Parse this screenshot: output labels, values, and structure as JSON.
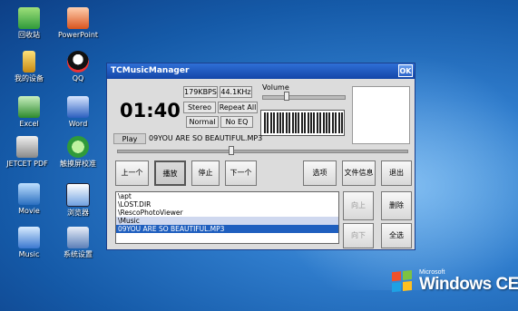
{
  "desktop": {
    "icons": [
      {
        "label": "回收站",
        "icon": "recycle-bin-icon"
      },
      {
        "label": "PowerPoint",
        "icon": "powerpoint-icon"
      },
      {
        "label": "我的设备",
        "icon": "my-device-icon"
      },
      {
        "label": "QQ",
        "icon": "qq-icon"
      },
      {
        "label": "Excel",
        "icon": "excel-icon"
      },
      {
        "label": "Word",
        "icon": "word-icon"
      },
      {
        "label": "JETCET PDF",
        "icon": "jetcet-pdf-icon"
      },
      {
        "label": "触摸屏校准",
        "icon": "touch-calibrate-icon"
      },
      {
        "label": "Movie",
        "icon": "movie-icon"
      },
      {
        "label": "浏览器",
        "icon": "browser-icon"
      },
      {
        "label": "Music",
        "icon": "music-icon"
      },
      {
        "label": "系统设置",
        "icon": "system-settings-icon"
      }
    ],
    "brand": {
      "small": "Microsoft",
      "text": "Windows CE"
    }
  },
  "window": {
    "title": "TCMusicManager",
    "ok_label": "OK",
    "time": "01:40",
    "bitrate": "179KBPS",
    "samplerate": "44.1KHz",
    "channels": "Stereo",
    "repeat": "Repeat All",
    "mode": "Normal",
    "eq": "No EQ",
    "volume_label": "Volume",
    "volume_level": 0.28,
    "seek_position": 0.39,
    "status": "Play",
    "track": "09YOU ARE SO BEAUTIFUL.MP3",
    "buttons": {
      "prev": "上一个",
      "play": "播放",
      "stop": "停止",
      "next": "下一个",
      "options": "选项",
      "file_info": "文件信息",
      "exit": "退出",
      "up": "向上",
      "delete": "删除",
      "down": "向下",
      "select_all": "全选"
    },
    "playlist": [
      "\\apt",
      "\\LOST.DIR",
      "\\RescoPhotoViewer",
      "\\Music",
      "09YOU ARE SO BEAUTIFUL.MP3"
    ],
    "selected_index": 4
  }
}
